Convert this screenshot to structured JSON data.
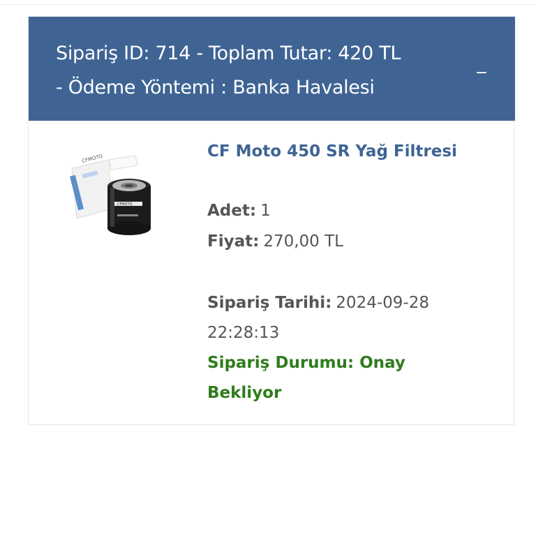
{
  "order": {
    "header_line1": "Sipariş ID: 714 - Toplam Tutar: 420 TL",
    "header_line2": "- Ödeme Yöntemi : Banka Havalesi",
    "collapse_symbol": "_",
    "header_color": "#3f6494"
  },
  "product": {
    "name": "CF Moto 450 SR Yağ Filtresi",
    "image_icon": "oil-filter-product-image",
    "box_text": "CFMOTO"
  },
  "details": {
    "quantity_label": "Adet:",
    "quantity_value": "1",
    "price_label": "Fiyat:",
    "price_value": "270,00 TL",
    "date_label": "Sipariş Tarihi:",
    "date_value_line1": "2024-09-28",
    "date_value_line2": "22:28:13",
    "status_label": "Sipariş Durumu:",
    "status_value": "Onay Bekliyor",
    "status_color": "#2f7d1c"
  }
}
